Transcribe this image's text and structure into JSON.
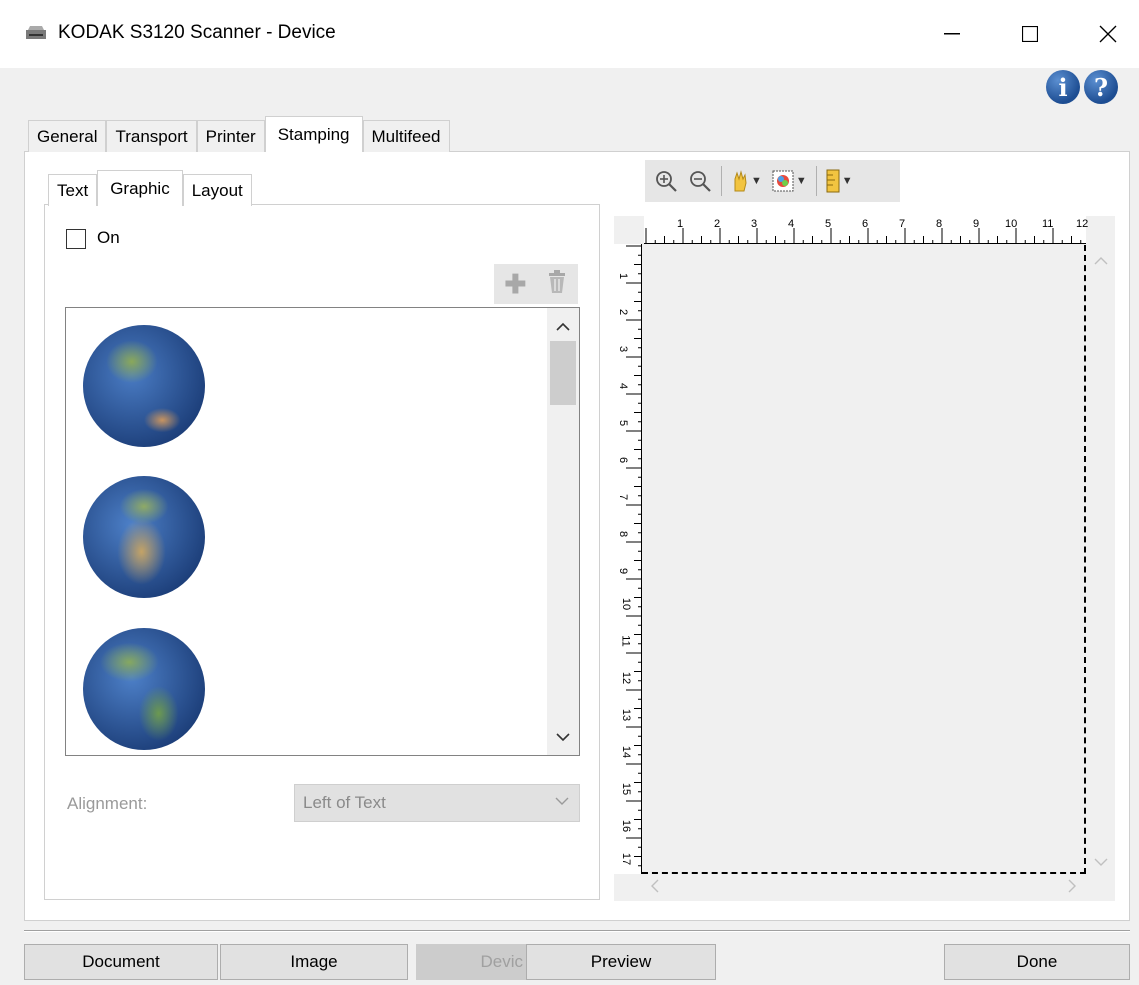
{
  "window": {
    "title": "KODAK S3120 Scanner - Device",
    "minimize": "—",
    "maximize": "☐",
    "close": "✕"
  },
  "help": {
    "info": "i",
    "help": "?"
  },
  "main_tabs": [
    {
      "label": "General"
    },
    {
      "label": "Transport"
    },
    {
      "label": "Printer"
    },
    {
      "label": "Stamping",
      "active": true
    },
    {
      "label": "Multifeed"
    }
  ],
  "sub_tabs": [
    {
      "label": "Text"
    },
    {
      "label": "Graphic",
      "active": true
    },
    {
      "label": "Layout"
    }
  ],
  "graphic": {
    "on_label": "On",
    "on_checked": false,
    "add_icon": "✚",
    "delete_icon": "🗑",
    "items": [
      {
        "icon": "globe-asia-australia-icon"
      },
      {
        "icon": "globe-europe-africa-icon"
      },
      {
        "icon": "globe-americas-icon"
      }
    ],
    "alignment_label": "Alignment:",
    "alignment_value": "Left of Text"
  },
  "preview_toolbar": {
    "zoom_in": "⊕",
    "zoom_out": "⊖",
    "hand": "✋",
    "color": "◙",
    "ruler": "▤"
  },
  "ruler": {
    "top_numbers": [
      "1",
      "2",
      "3",
      "4",
      "5",
      "6",
      "7",
      "8",
      "9",
      "10",
      "11",
      "12"
    ],
    "left_numbers": [
      "1",
      "2",
      "3",
      "4",
      "5",
      "6",
      "7",
      "8",
      "9",
      "10",
      "11",
      "12",
      "13",
      "14",
      "15",
      "16",
      "17"
    ]
  },
  "bottom_buttons": {
    "document": "Document",
    "image": "Image",
    "device": "Devic",
    "preview": "Preview",
    "done": "Done"
  }
}
